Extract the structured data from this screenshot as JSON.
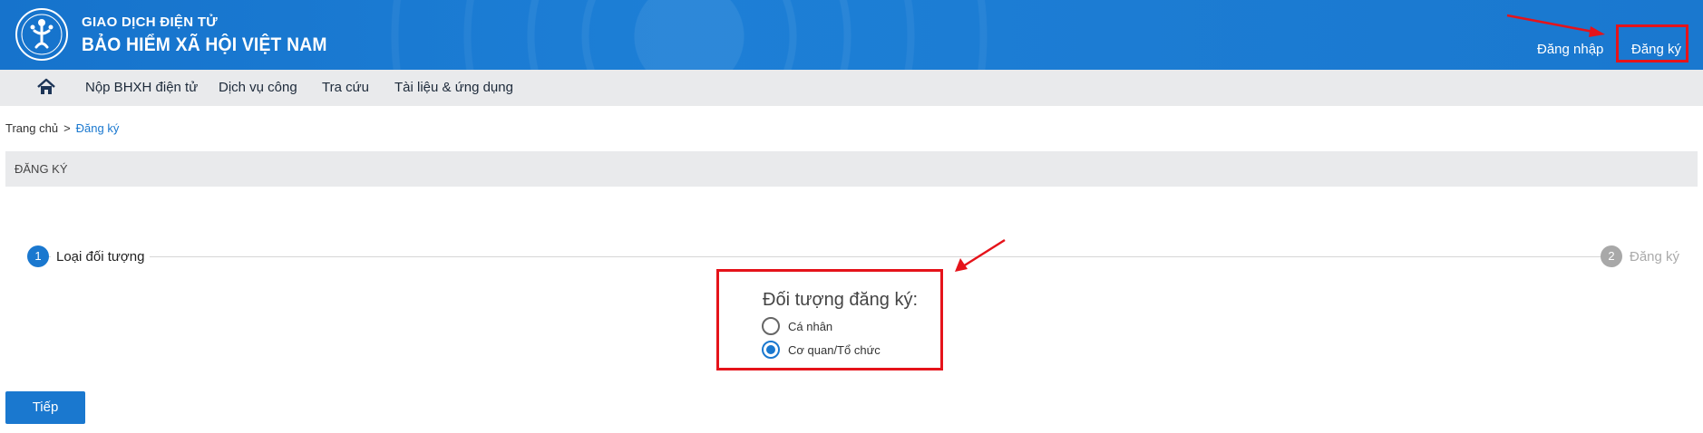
{
  "header": {
    "brand_top": "GIAO DỊCH ĐIỆN TỬ",
    "brand_main": "BẢO HIỂM XÃ HỘI VIỆT NAM",
    "login_label": "Đăng nhập",
    "register_label": "Đăng ký",
    "logo_icon": "bhxh-logo-icon",
    "bg_color": "#1a78cf"
  },
  "nav": {
    "home_icon": "home-icon",
    "items": [
      {
        "label": "Nộp BHXH điện tử"
      },
      {
        "label": "Dịch vụ công"
      },
      {
        "label": "Tra cứu"
      },
      {
        "label": "Tài liệu & ứng dụng"
      }
    ]
  },
  "breadcrumb": {
    "home": "Trang chủ",
    "separator": ">",
    "current": "Đăng ký"
  },
  "section": {
    "title": "ĐĂNG KÝ"
  },
  "stepper": {
    "steps": [
      {
        "number": "1",
        "label": "Loại đối tượng",
        "active": true
      },
      {
        "number": "2",
        "label": "Đăng ký",
        "active": false
      }
    ]
  },
  "form": {
    "title": "Đối tượng đăng ký:",
    "options": [
      {
        "label": "Cá nhân",
        "checked": false
      },
      {
        "label": "Cơ quan/Tổ chức",
        "checked": true
      }
    ]
  },
  "actions": {
    "next_label": "Tiếp"
  },
  "annotation_color": "#e5131a"
}
